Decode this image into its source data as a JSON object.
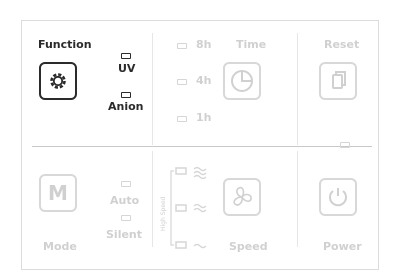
{
  "function": {
    "label": "Function",
    "uv_label": "UV",
    "anion_label": "Anion"
  },
  "timer": {
    "label": "Time",
    "options": [
      "8h",
      "4h",
      "1h"
    ]
  },
  "reset": {
    "label": "Reset"
  },
  "mode": {
    "label": "Mode",
    "button_text": "M",
    "options": [
      "Auto",
      "Silent"
    ]
  },
  "speed": {
    "label": "Speed",
    "side_label": "High Speed"
  },
  "power": {
    "label": "Power"
  },
  "colors": {
    "active": "#2b2b2b",
    "inactive": "#d0d0d0"
  }
}
